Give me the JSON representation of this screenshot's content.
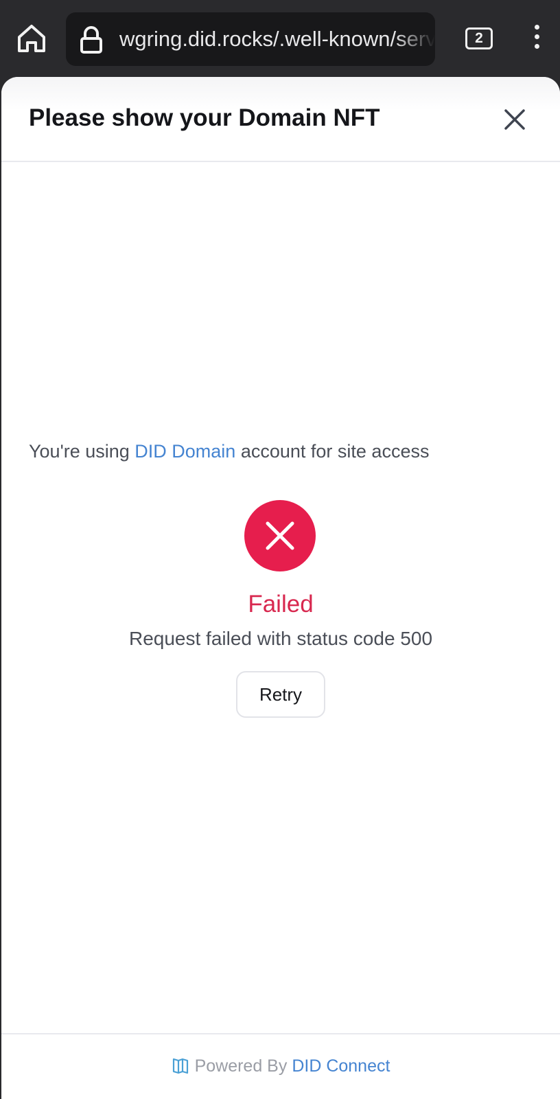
{
  "browser": {
    "url": "wgring.did.rocks/.well-known/servi",
    "tab_count": "2"
  },
  "modal": {
    "title": "Please show your Domain NFT",
    "body_prefix": "You're using ",
    "body_link": "DID Domain",
    "body_suffix": " account for site access",
    "status_title": "Failed",
    "status_message": "Request failed with status code 500",
    "retry_label": "Retry"
  },
  "footer": {
    "powered_by": "Powered By",
    "brand": "DID Connect"
  },
  "colors": {
    "accent": "#4584d1",
    "error": "#e61e4d",
    "error_text": "#d8284f"
  }
}
